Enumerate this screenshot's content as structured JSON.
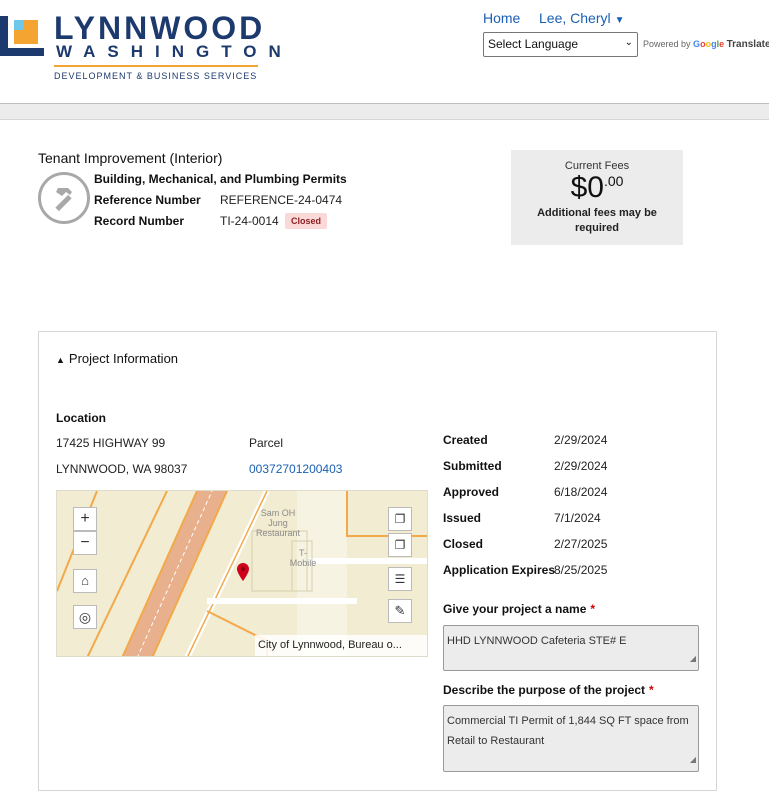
{
  "header": {
    "logo": {
      "title": "LYNNWOOD",
      "subtitle": "WASHINGTON",
      "department": "DEVELOPMENT & BUSINESS SERVICES"
    },
    "nav": {
      "home": "Home",
      "user": "Lee, Cheryl"
    },
    "language": {
      "selected": "Select Language",
      "powered_by": "Powered by",
      "google": "Google",
      "translate": "Translate"
    }
  },
  "record": {
    "title": "Tenant Improvement (Interior)",
    "type": "Building, Mechanical, and Plumbing Permits",
    "reference_label": "Reference Number",
    "reference_value": "REFERENCE-24-0474",
    "record_label": "Record Number",
    "record_value": "TI-24-0014",
    "status": "Closed"
  },
  "fees": {
    "label": "Current Fees",
    "amount_main": "$0",
    "amount_cents": ".00",
    "note": "Additional fees may be required"
  },
  "project": {
    "section_title": "Project Information",
    "location_heading": "Location",
    "address_line1": "17425 HIGHWAY 99",
    "address_line2": "LYNNWOOD, WA 98037",
    "parcel_label": "Parcel",
    "parcel_number": "00372701200403",
    "map": {
      "attribution": "City of Lynnwood, Bureau o...",
      "poi_1": "Sam OH\nJung\nRestaurant",
      "poi_2": "T-\nMobile"
    },
    "dates": [
      {
        "label": "Created",
        "value": "2/29/2024"
      },
      {
        "label": "Submitted",
        "value": "2/29/2024"
      },
      {
        "label": "Approved",
        "value": "6/18/2024"
      },
      {
        "label": "Issued",
        "value": "7/1/2024"
      },
      {
        "label": "Closed",
        "value": "2/27/2025"
      },
      {
        "label": "Application Expires",
        "value": "8/25/2025"
      }
    ],
    "name_label": "Give your project a name",
    "name_value": "HHD LYNNWOOD Cafeteria STE# E",
    "purpose_label": "Describe the purpose of the project",
    "purpose_value": "Commercial TI Permit of 1,844 SQ FT space from Retail to Restaurant",
    "required_marker": "*"
  },
  "colors": {
    "brand_navy": "#1d3a6e",
    "brand_orange": "#f3a431",
    "link_blue": "#1a5fb4",
    "status_closed_bg": "#fbd9d9",
    "required_red": "#d40000"
  }
}
